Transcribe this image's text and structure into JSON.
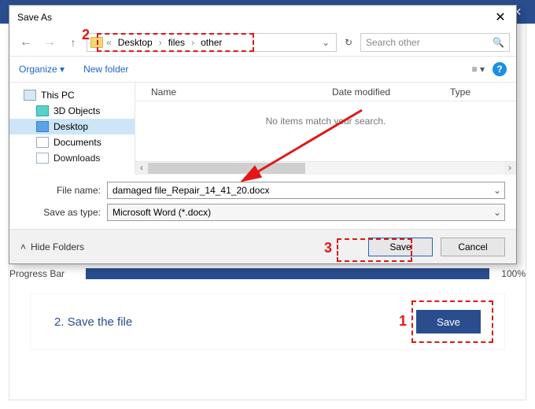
{
  "outer": {
    "minimize": "—",
    "close": "✕"
  },
  "progress": {
    "label": "Progress Bar",
    "percent": "100%"
  },
  "step": {
    "label": "2. Save the file",
    "button": "Save"
  },
  "callouts": {
    "a": "1",
    "b": "2",
    "c": "3"
  },
  "dialog": {
    "title": "Save As",
    "close": "✕",
    "nav": {
      "back": "←",
      "fwd": "→",
      "up": "↑"
    },
    "crumbs_prefix": "«",
    "crumbs": [
      "Desktop",
      "files",
      "other"
    ],
    "addr_drop": "⌄",
    "refresh": "↻",
    "search_placeholder": "Search other",
    "search_icon": "🔍",
    "organize": "Organize ▾",
    "new_folder": "New folder",
    "help": "?",
    "tree": {
      "this_pc": "This PC",
      "objects3d": "3D Objects",
      "desktop": "Desktop",
      "documents": "Documents",
      "downloads": "Downloads"
    },
    "columns": {
      "name": "Name",
      "date": "Date modified",
      "type": "Type"
    },
    "empty": "No items match your search.",
    "filename_label": "File name:",
    "filename_value": "damaged file_Repair_14_41_20.docx",
    "type_label": "Save as type:",
    "type_value": "Microsoft Word (*.docx)",
    "hide_folders_icon": "˄",
    "hide_folders": "Hide Folders",
    "save": "Save",
    "cancel": "Cancel"
  }
}
